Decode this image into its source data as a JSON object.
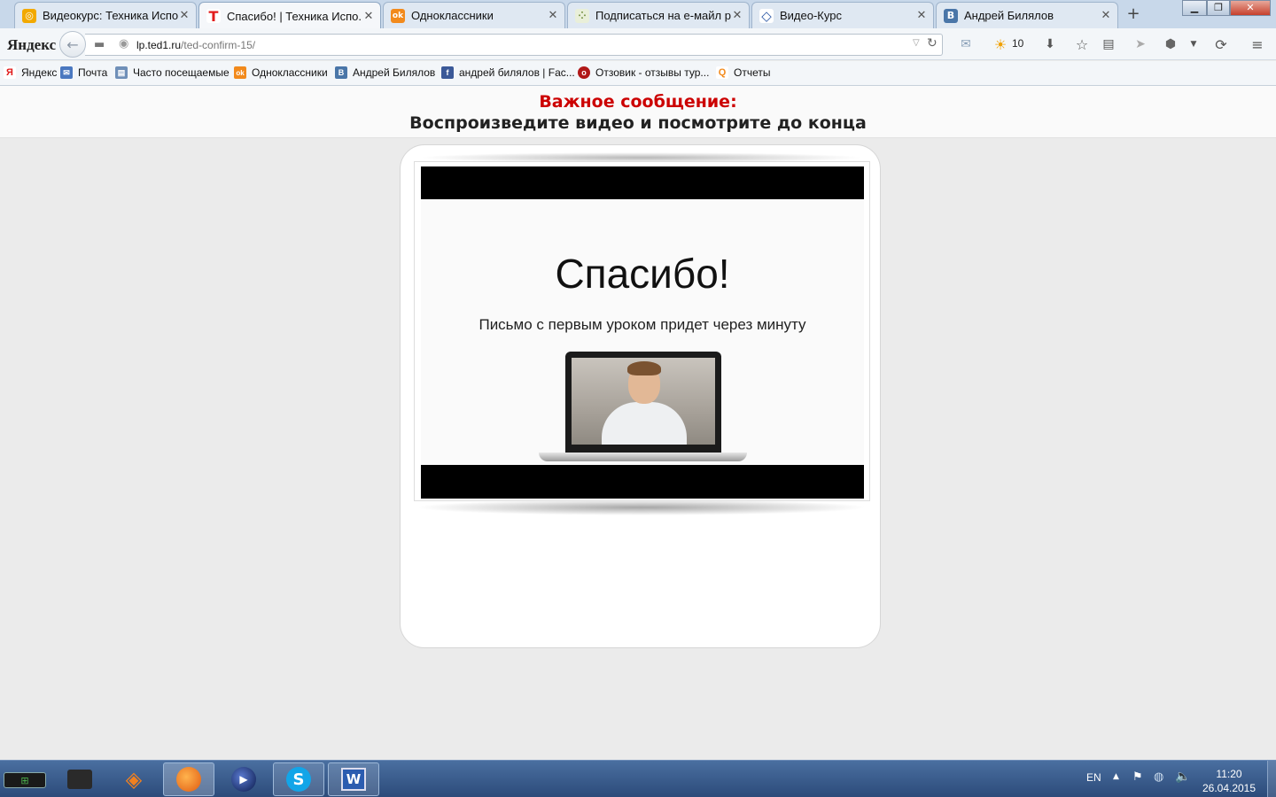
{
  "tabs": [
    {
      "title": "Видеокурс: Техника Испо...",
      "favicon": "yandex-browser-icon",
      "color": "#f2a900",
      "glyph": "◎"
    },
    {
      "title": "Спасибо! | Техника Испо...",
      "favicon": "ted-t-icon",
      "color": "#e21b1b",
      "glyph": "T"
    },
    {
      "title": "Одноклассники",
      "favicon": "odnoklassniki-icon",
      "color": "#f28a1c",
      "glyph": "ok"
    },
    {
      "title": "Подписаться на e-майл р...",
      "favicon": "dots-icon",
      "color": "#9bb06a",
      "glyph": "⁘"
    },
    {
      "title": "Видео-Курс",
      "favicon": "diamond-icon",
      "color": "#2a56a4",
      "glyph": "◇"
    },
    {
      "title": "Андрей Билялов",
      "favicon": "vk-icon",
      "color": "#4a76a8",
      "glyph": "B"
    }
  ],
  "address_bar": {
    "brand": "Яндекс",
    "url_domain": "lp.ted1.ru",
    "url_path": "/ted-confirm-15/"
  },
  "toolbar": {
    "weather": "10"
  },
  "bookmarks": [
    {
      "label": "Яндекс",
      "favicon": "yandex-icon",
      "color": "#e01b1b",
      "glyph": "Я"
    },
    {
      "label": "Почта",
      "favicon": "mail-icon",
      "color": "#4a78c0",
      "glyph": "✉"
    },
    {
      "label": "Часто посещаемые",
      "favicon": "folder-icon",
      "color": "#6f8fb8",
      "glyph": "▤"
    },
    {
      "label": "Одноклассники",
      "favicon": "odnoklassniki-icon",
      "color": "#f28a1c",
      "glyph": "ok"
    },
    {
      "label": "Андрей Билялов",
      "favicon": "vk-icon",
      "color": "#4a76a8",
      "glyph": "B"
    },
    {
      "label": "андрей билялов | Fac...",
      "favicon": "facebook-icon",
      "color": "#3b5998",
      "glyph": "f"
    },
    {
      "label": "Отзовик - отзывы тур...",
      "favicon": "otzovik-icon",
      "color": "#b01818",
      "glyph": "o"
    },
    {
      "label": "Отчеты",
      "favicon": "search-icon",
      "color": "#f28a1c",
      "glyph": "Q"
    }
  ],
  "page": {
    "headline": "Важное сообщение:",
    "subheadline": "Воспроизведите видео и посмотрите до конца",
    "video": {
      "title": "Спасибо!",
      "subtitle": "Письмо с первым уроком придет через минуту"
    }
  },
  "taskbar": {
    "language": "EN",
    "time": "11:20",
    "date": "26.04.2015"
  }
}
